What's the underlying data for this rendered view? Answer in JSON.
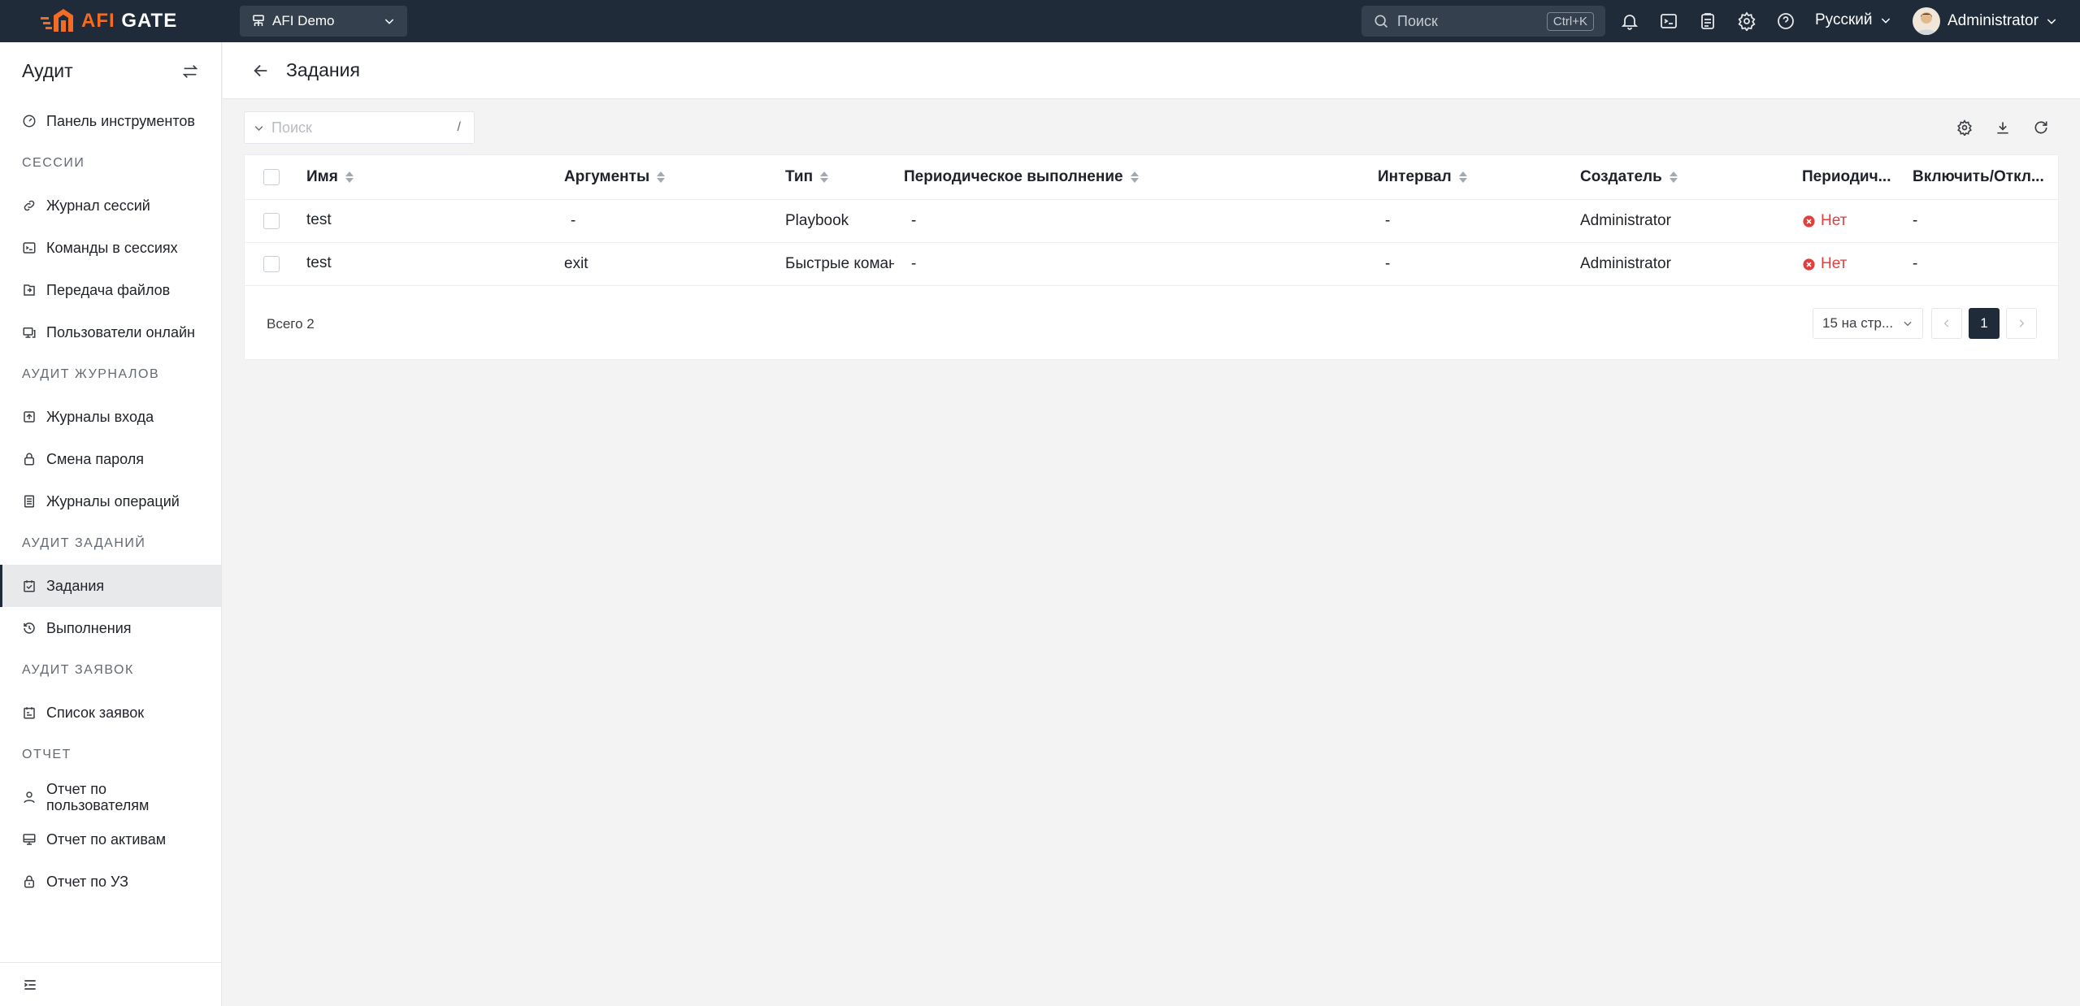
{
  "brand": {
    "name_part1": "AFI",
    "name_part2": " GATE",
    "accent": "#f46b24"
  },
  "topbar": {
    "org": "AFI Demo",
    "search_placeholder": "Поиск",
    "search_shortcut": "Ctrl+K",
    "language": "Русский",
    "user": "Administrator"
  },
  "sidebar": {
    "title": "Аудит",
    "items": {
      "dashboard": "Панель инструментов",
      "sec_sessions": "СЕССИИ",
      "session_log": "Журнал сессий",
      "session_commands": "Команды в сессиях",
      "file_transfer": "Передача файлов",
      "online_users": "Пользователи онлайн",
      "sec_logs": "АУДИТ ЖУРНАЛОВ",
      "login_logs": "Журналы входа",
      "password_change": "Смена пароля",
      "operation_logs": "Журналы операций",
      "sec_jobs": "АУДИТ ЗАДАНИЙ",
      "jobs": "Задания",
      "executions": "Выполнения",
      "sec_tickets": "АУДИТ ЗАЯВОК",
      "ticket_list": "Список заявок",
      "sec_report": "ОТЧЕТ",
      "user_report_1": "Отчет по",
      "user_report_2": "пользователям",
      "asset_report": "Отчет по активам",
      "account_report": "Отчет по УЗ"
    }
  },
  "page": {
    "title": "Задания",
    "filter_placeholder": "Поиск",
    "filter_shortcut": "/"
  },
  "table": {
    "columns": {
      "name": "Имя",
      "args": "Аргументы",
      "type": "Тип",
      "periodic": "Периодическое выполнение",
      "interval": "Интервал",
      "creator": "Создатель",
      "periodic_short": "Периодич...",
      "toggle": "Включить/Откл..."
    },
    "rows": [
      {
        "name": "test",
        "args": "-",
        "type": "Playbook",
        "periodic": "-",
        "interval": "-",
        "creator": "Administrator",
        "periodic_short": "Нет",
        "toggle": "-"
      },
      {
        "name": "test",
        "args": "exit",
        "type": "Быстрые коман",
        "periodic": "-",
        "interval": "-",
        "creator": "Administrator",
        "periodic_short": "Нет",
        "toggle": "-"
      }
    ],
    "total": "Всего 2",
    "page_size": "15 на стр...",
    "current_page": "1"
  },
  "colors": {
    "topbar": "#1f2b38",
    "danger": "#e23e3e"
  }
}
